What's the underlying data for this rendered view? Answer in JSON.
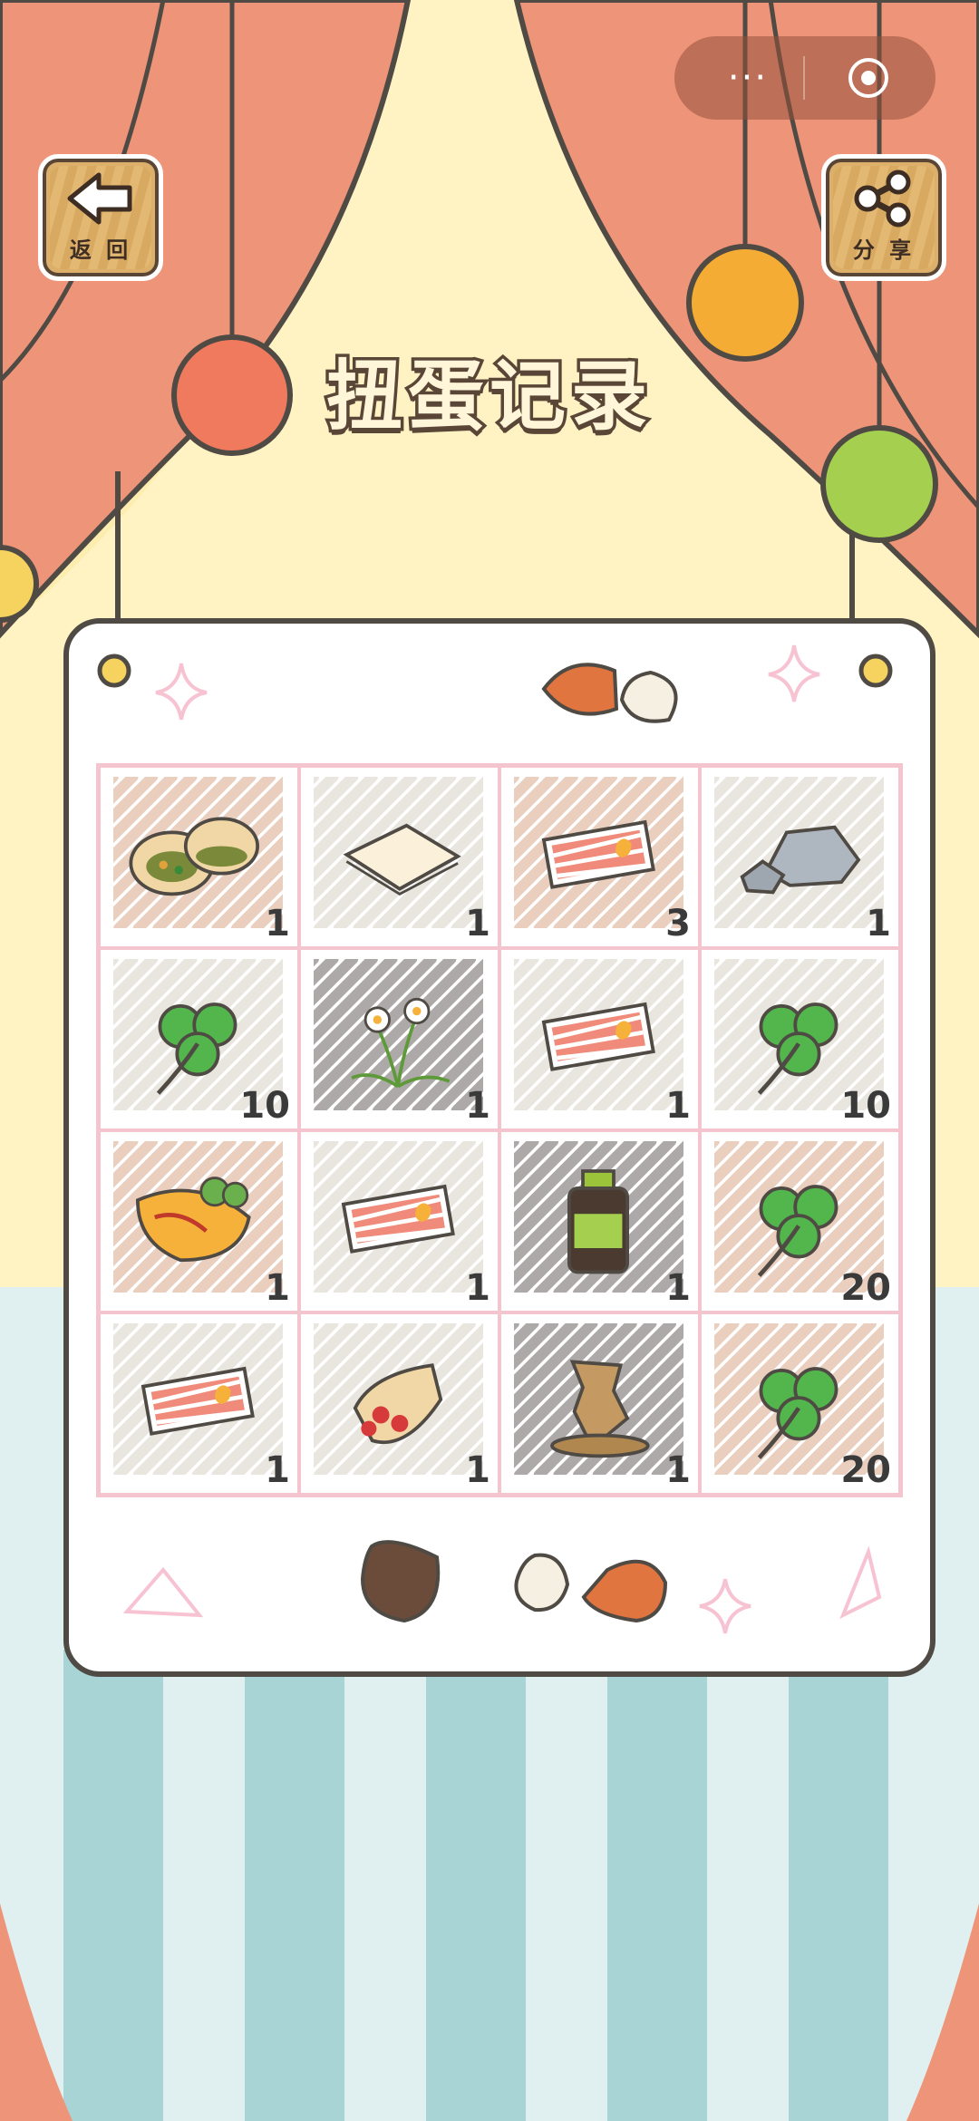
{
  "header": {
    "title": "扭蛋记录",
    "back_label": "返 回",
    "share_label": "分 享",
    "capsule_more": "···"
  },
  "colors": {
    "curtain": "#ee9478",
    "wall": "#fdeeb0",
    "stripe": "#a8d4d6",
    "grid_border": "#f4c4cf",
    "outline": "#4f4a44"
  },
  "items": [
    {
      "name": "bread-icon",
      "count": "1",
      "hatch": "brown"
    },
    {
      "name": "paper-icon",
      "count": "1",
      "hatch": "grey"
    },
    {
      "name": "ticket-icon",
      "count": "3",
      "hatch": "brown"
    },
    {
      "name": "stone-icon",
      "count": "1",
      "hatch": "grey"
    },
    {
      "name": "clover-icon",
      "count": "10",
      "hatch": "grey"
    },
    {
      "name": "daffodil-icon",
      "count": "1",
      "hatch": "dark"
    },
    {
      "name": "ticket-icon",
      "count": "1",
      "hatch": "grey"
    },
    {
      "name": "clover-icon",
      "count": "10",
      "hatch": "grey"
    },
    {
      "name": "omelette-icon",
      "count": "1",
      "hatch": "brown"
    },
    {
      "name": "ticket-icon",
      "count": "1",
      "hatch": "grey"
    },
    {
      "name": "bottle-icon",
      "count": "1",
      "hatch": "dark"
    },
    {
      "name": "clover-icon",
      "count": "20",
      "hatch": "brown"
    },
    {
      "name": "ticket-icon",
      "count": "1",
      "hatch": "grey"
    },
    {
      "name": "crepe-icon",
      "count": "1",
      "hatch": "grey"
    },
    {
      "name": "wood-carving-icon",
      "count": "1",
      "hatch": "dark"
    },
    {
      "name": "clover-icon",
      "count": "20",
      "hatch": "brown"
    }
  ]
}
